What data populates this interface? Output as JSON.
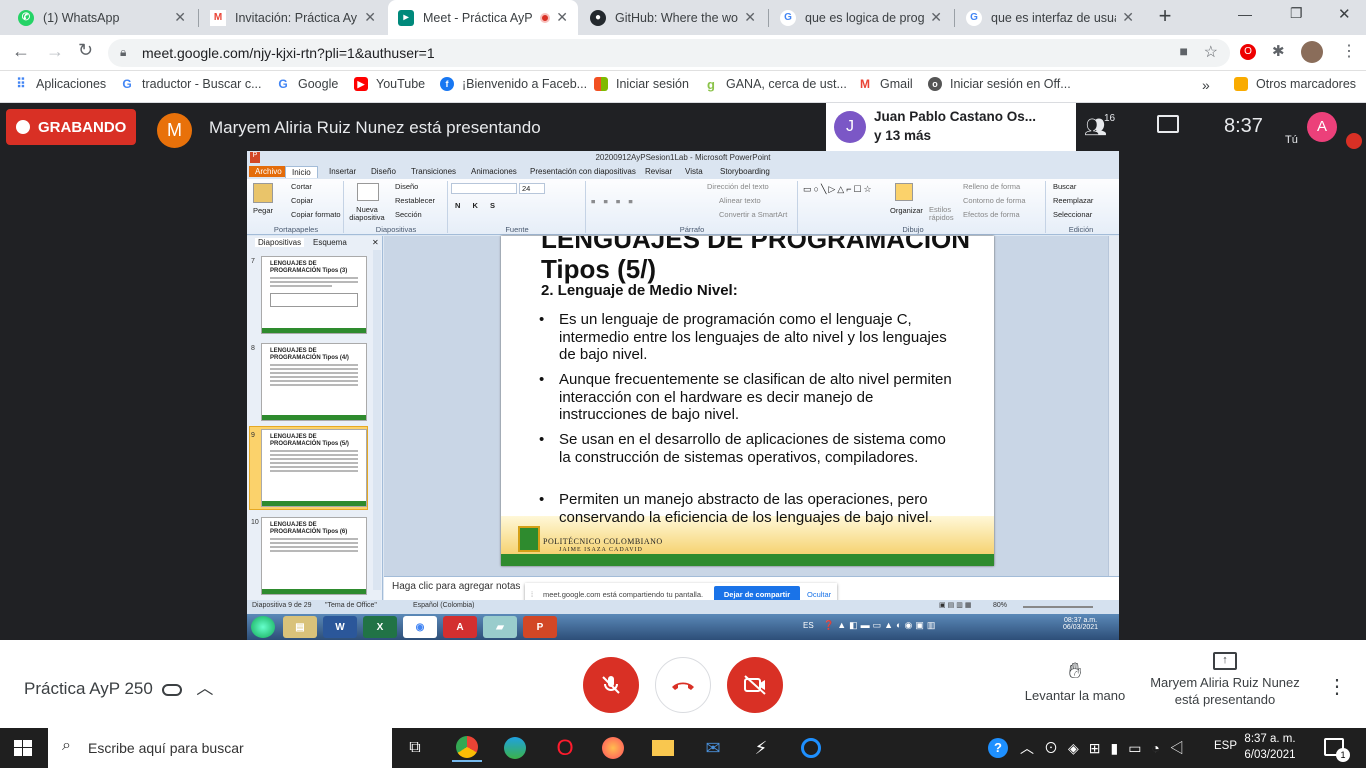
{
  "browser": {
    "tabs": [
      {
        "label": "(1) WhatsApp",
        "icon": "whatsapp-icon",
        "color": "#25d366"
      },
      {
        "label": "Invitación: Práctica AyP",
        "icon": "gmail-icon",
        "color": "#ea4335"
      },
      {
        "label": "Meet - Práctica AyP",
        "icon": "meet-icon",
        "color": "#00897b"
      },
      {
        "label": "GitHub: Where the worl",
        "icon": "github-icon",
        "color": "#24292e"
      },
      {
        "label": "que es logica de progra",
        "icon": "google-icon",
        "color": "#4285f4"
      },
      {
        "label": "que es interfaz de usua",
        "icon": "google-icon",
        "color": "#4285f4"
      }
    ],
    "url": "meet.google.com/njy-kjxi-rtn?pli=1&authuser=1",
    "bookmarks": [
      {
        "label": "Aplicaciones",
        "icon": "apps-grid-icon",
        "color": "#4285f4"
      },
      {
        "label": "traductor - Buscar c...",
        "icon": "google-icon",
        "color": "#4285f4"
      },
      {
        "label": "Google",
        "icon": "google-icon",
        "color": "#4285f4"
      },
      {
        "label": "YouTube",
        "icon": "youtube-icon",
        "color": "#ff0000"
      },
      {
        "label": "¡Bienvenido a Faceb...",
        "icon": "facebook-icon",
        "color": "#1877f2"
      },
      {
        "label": "Iniciar sesión",
        "icon": "microsoft-icon",
        "color": "#f25022"
      },
      {
        "label": "GANA, cerca de ust...",
        "icon": "gana-icon",
        "color": "#8bc34a"
      },
      {
        "label": "Gmail",
        "icon": "gmail-icon",
        "color": "#ea4335"
      },
      {
        "label": "Iniciar sesión en Off...",
        "icon": "office-icon",
        "color": "#555555"
      }
    ],
    "bookmarks_overflow": "»",
    "other_bookmarks": "Otros marcadores"
  },
  "meet": {
    "recording_label": "GRABANDO",
    "presenter_initial": "M",
    "presenting_text": "Maryem Aliria Ruiz Nunez está presentando",
    "pinned_initial": "J",
    "pinned_name": "Juan Pablo Castano Os...",
    "pinned_more": "y 13 más",
    "participants_count": "16",
    "time": "8:37",
    "self_initial": "A",
    "self_label": "Tú",
    "meeting_code": "Práctica AyP 250",
    "raise_hand": "Levantar la mano",
    "presenter_line1": "Maryem Aliria Ruiz Nunez",
    "presenter_line2": "está presentando"
  },
  "powerpoint": {
    "title": "20200912AyPSesion1Lab  -  Microsoft PowerPoint",
    "ribbon_tabs": [
      "Archivo",
      "Inicio",
      "Insertar",
      "Diseño",
      "Transiciones",
      "Animaciones",
      "Presentación con diapositivas",
      "Revisar",
      "Vista",
      "Storyboarding"
    ],
    "clipboard": {
      "paste": "Pegar",
      "cut": "Cortar",
      "copy": "Copiar",
      "format": "Copiar formato",
      "group": "Portapapeles"
    },
    "slides_group": {
      "new": "Nueva diapositiva",
      "layout": "Diseño",
      "reset": "Restablecer",
      "section": "Sección",
      "group": "Diapositivas"
    },
    "font_group": {
      "size": "24",
      "group": "Fuente"
    },
    "paragraph_group": {
      "dir": "Dirección del texto",
      "align": "Alinear texto",
      "smartart": "Convertir a SmartArt",
      "group": "Párrafo"
    },
    "drawing_group": {
      "arrange": "Organizar",
      "styles": "Estilos rápidos",
      "fill": "Relleno de forma",
      "outline": "Contorno de forma",
      "effects": "Efectos de forma",
      "group": "Dibujo"
    },
    "edit_group": {
      "find": "Buscar",
      "replace": "Reemplazar",
      "select": "Seleccionar",
      "group": "Edición"
    },
    "pane_tabs": [
      "Diapositivas",
      "Esquema"
    ],
    "thumbs": [
      {
        "num": "7",
        "title": "LENGUAJES DE PROGRAMACIÓN Tipos (3)"
      },
      {
        "num": "8",
        "title": "LENGUAJES DE PROGRAMACIÓN Tipos (4/)"
      },
      {
        "num": "9",
        "title": "LENGUAJES DE PROGRAMACIÓN Tipos (5/)"
      },
      {
        "num": "10",
        "title": "LENGUAJES DE PROGRAMACIÓN Tipos (6)"
      }
    ],
    "slide": {
      "heading_top": "LENGUAJES DE PROGRAMACIÓN",
      "heading": "Tipos (5/)",
      "subtitle": "2. Lenguaje de Medio Nivel:",
      "bullets": [
        "Es un lenguaje de programación como el lenguaje C, intermedio entre los lenguajes de alto nivel y los lenguajes de bajo nivel.",
        "Aunque frecuentemente se clasifican de alto nivel permiten interacción con el hardware es decir manejo de instrucciones de bajo nivel.",
        "Se usan en el desarrollo de aplicaciones de sistema como la construcción de sistemas operativos, compiladores.",
        "Permiten un manejo abstracto de las operaciones, pero conservando la eficiencia de los lenguajes de bajo nivel."
      ],
      "footer1": "POLITÉCNICO COLOMBIANO",
      "footer2": "JAIME ISAZA CADAVID"
    },
    "notes_placeholder": "Haga clic para agregar notas",
    "share_msg": "meet.google.com está compartiendo tu pantalla.",
    "stop_share": "Dejar de compartir",
    "hide": "Ocultar",
    "status_slide": "Diapositiva 9 de 29",
    "status_theme": "\"Tema de Office\"",
    "status_lang": "Español (Colombia)",
    "status_zoom": "80%",
    "inner_lang": "ES",
    "inner_time": "08:37 a.m.",
    "inner_date": "06/03/2021"
  },
  "windows": {
    "search_placeholder": "Escribe aquí para buscar",
    "lang": "ESP",
    "time": "8:37 a. m.",
    "date": "6/03/2021",
    "notif_count": "1"
  }
}
